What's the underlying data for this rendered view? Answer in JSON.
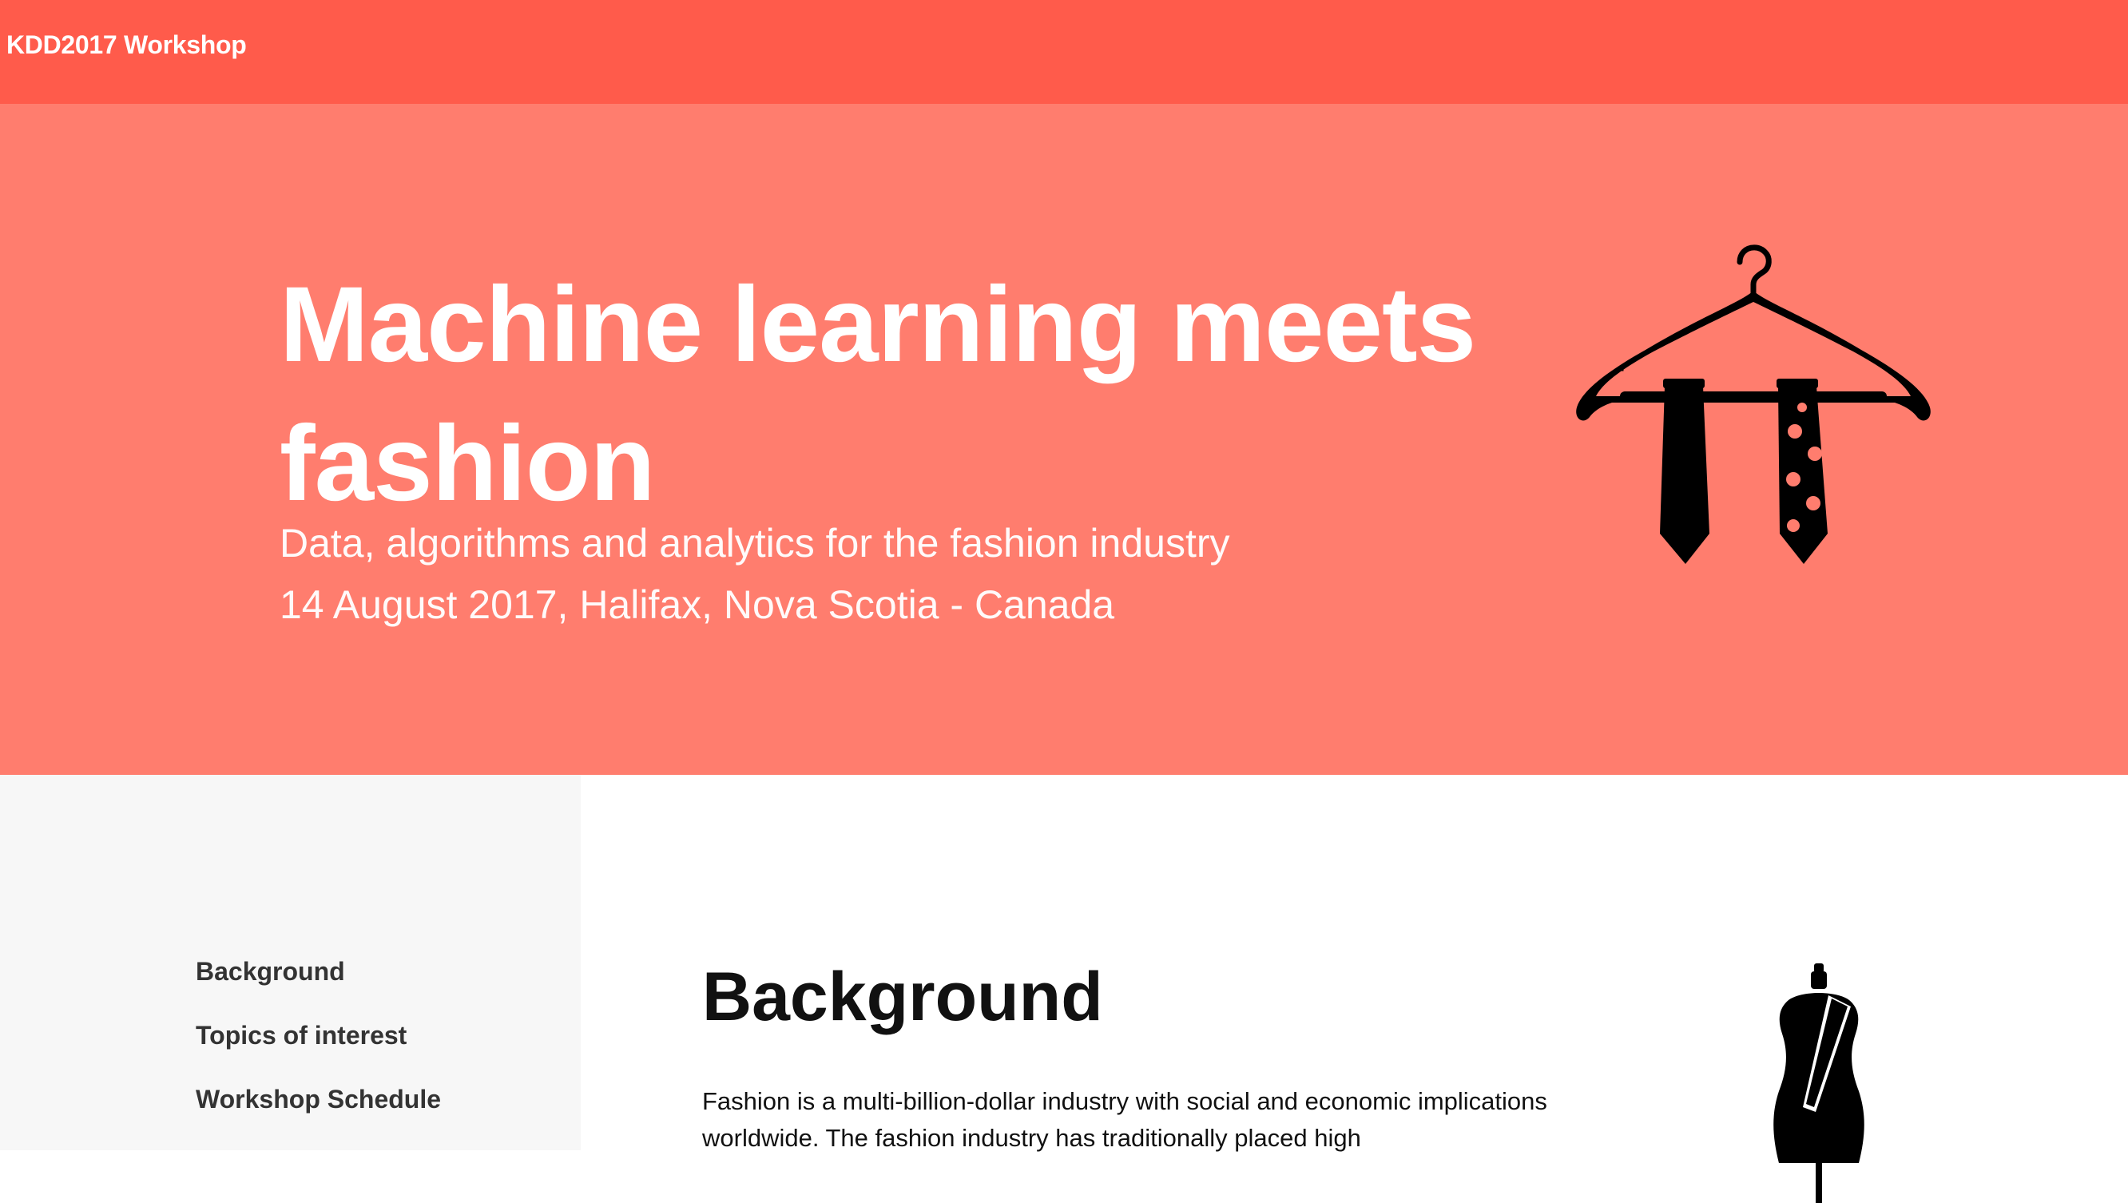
{
  "navbar": {
    "brand": "KDD2017 Workshop",
    "background_color": "#ff5b4b"
  },
  "hero": {
    "title": "Machine learning meets fashion",
    "subtitle": "Data, algorithms and analytics for the fashion industry",
    "date_location": "14 August 2017, Halifax, Nova Scotia - Canada",
    "icon": "clothes-hanger-with-ties-icon",
    "background_color": "#ff7d6e"
  },
  "sidebar": {
    "items": [
      {
        "label": "Background"
      },
      {
        "label": "Topics of interest"
      },
      {
        "label": "Workshop Schedule"
      }
    ]
  },
  "main": {
    "section_title": "Background",
    "body": "Fashion is a multi-billion-dollar industry with social and economic implications worldwide. The fashion industry has traditionally placed high",
    "icon": "mannequin-icon"
  }
}
